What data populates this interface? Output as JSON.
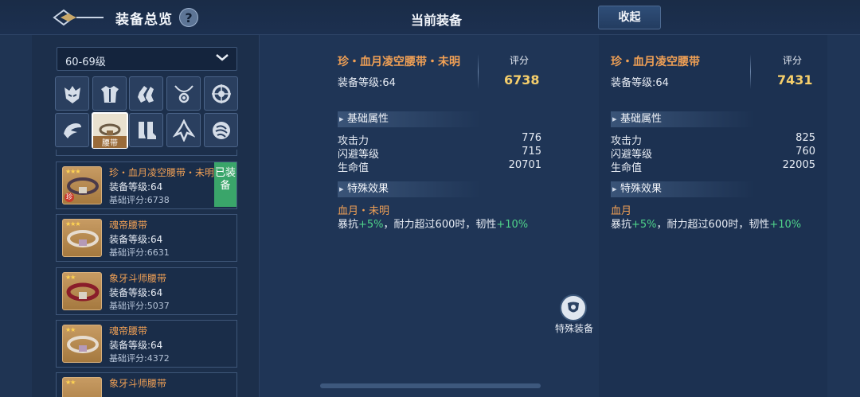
{
  "header": {
    "title": "装备总览",
    "help": "?",
    "center_title": "当前装备",
    "collapse_label": "收起"
  },
  "filter": {
    "selected_level": "60-69级"
  },
  "slots": [
    {
      "icon": "helmet-icon"
    },
    {
      "icon": "armor-icon"
    },
    {
      "icon": "gloves-icon"
    },
    {
      "icon": "necklace-icon"
    },
    {
      "icon": "ring-icon"
    },
    {
      "icon": "shoulder-icon"
    },
    {
      "icon": "belt-icon",
      "label": "腰带",
      "active": true
    },
    {
      "icon": "boots-icon"
    },
    {
      "icon": "cloak-icon"
    },
    {
      "icon": "bracer-icon"
    }
  ],
  "items": [
    {
      "name": "珍・血月凌空腰带・未明",
      "level": "装备等级:64",
      "score": "基础评分:6738",
      "equipped": "已装备",
      "rare_mark": "珍"
    },
    {
      "name": "魂帝腰带",
      "level": "装备等级:64",
      "score": "基础评分:6631"
    },
    {
      "name": "象牙斗师腰带",
      "level": "装备等级:64",
      "score": "基础评分:5037"
    },
    {
      "name": "魂帝腰带",
      "level": "装备等级:64",
      "score": "基础评分:4372"
    },
    {
      "name": "象牙斗师腰带"
    }
  ],
  "current": {
    "name": "珍・血月凌空腰带・未明",
    "level": "装备等级:64",
    "score_label": "评分",
    "score": "6738",
    "base_title": "基础属性",
    "stats": [
      {
        "name": "攻击力",
        "value": "776"
      },
      {
        "name": "闪避等级",
        "value": "715"
      },
      {
        "name": "生命值",
        "value": "20701"
      }
    ],
    "special_title": "特殊效果",
    "effect_name": "血月・未明",
    "effect": {
      "a": "暴抗",
      "b": "+5%",
      "c": "，耐力超过600时，韧性",
      "d": "+10%"
    }
  },
  "compare": {
    "name": "珍・血月凌空腰带",
    "level": "装备等级:64",
    "score_label": "评分",
    "score": "7431",
    "base_title": "基础属性",
    "stats": [
      {
        "name": "攻击力",
        "value": "825"
      },
      {
        "name": "闪避等级",
        "value": "760"
      },
      {
        "name": "生命值",
        "value": "22005"
      }
    ],
    "special_title": "特殊效果",
    "effect_name": "血月",
    "effect": {
      "a": "暴抗",
      "b": "+5%",
      "c": "，耐力超过600时，韧性",
      "d": "+10%"
    }
  },
  "special_equipment_label": "特殊装备",
  "colors": {
    "orange": "#f0a055",
    "gold": "#f6cf6b",
    "green": "#4fd38a",
    "bg": "#1f3453"
  }
}
